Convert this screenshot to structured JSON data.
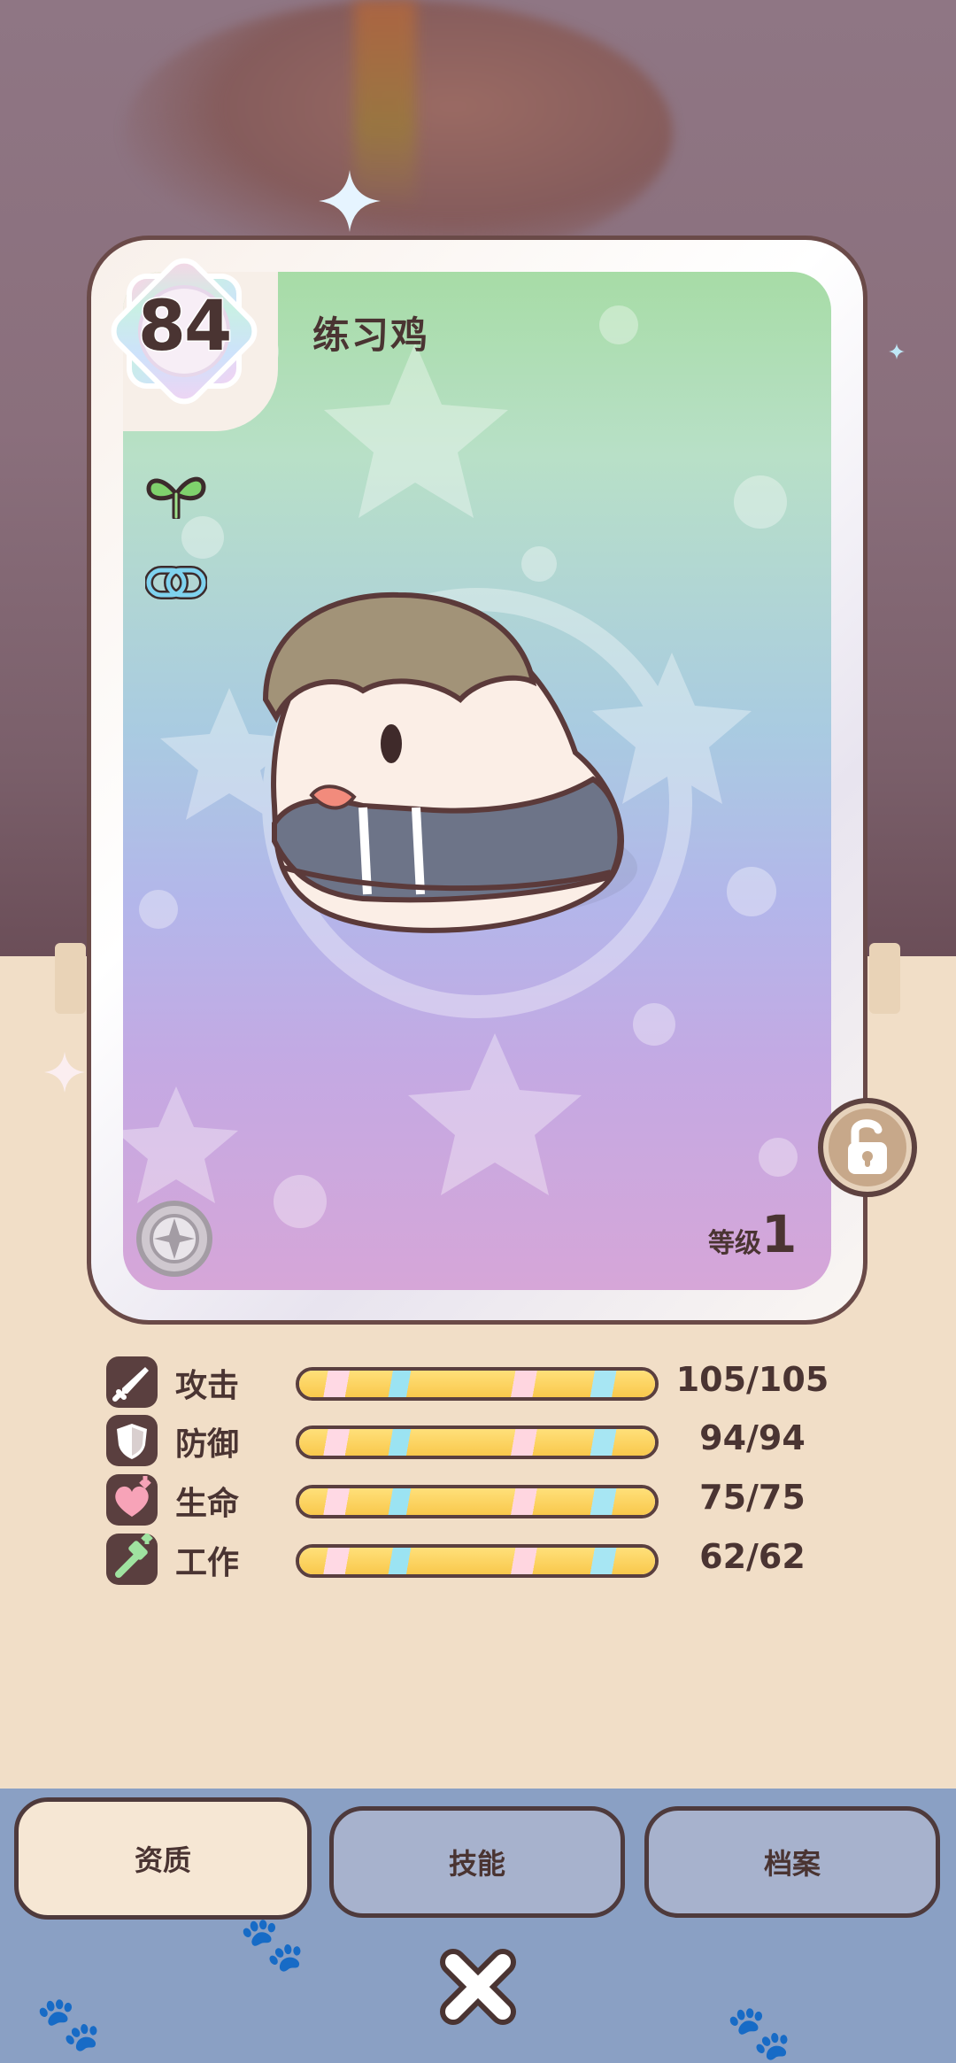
{
  "character": {
    "name": "练习鸡",
    "score": "84",
    "level_label": "等级",
    "level_value": "1"
  },
  "traits": [
    {
      "icon": "sprout-icon"
    },
    {
      "icon": "link-icon"
    }
  ],
  "stats": [
    {
      "key": "attack",
      "label": "攻击",
      "value": "105/105",
      "fill": 1.0,
      "icon": "sword-icon"
    },
    {
      "key": "defense",
      "label": "防御",
      "value": "94/94",
      "fill": 1.0,
      "icon": "shield-icon"
    },
    {
      "key": "life",
      "label": "生命",
      "value": "75/75",
      "fill": 1.0,
      "icon": "heart-icon"
    },
    {
      "key": "work",
      "label": "工作",
      "value": "62/62",
      "fill": 1.0,
      "icon": "hammer-icon"
    }
  ],
  "tabs": [
    {
      "label": "资质",
      "active": true
    },
    {
      "label": "技能",
      "active": false
    },
    {
      "label": "档案",
      "active": false
    }
  ],
  "colors": {
    "outline": "#4a3432",
    "panel_blue": "#8aa0c4",
    "ground": "#f1dec7",
    "bar_yellow": "#ffe07a"
  }
}
